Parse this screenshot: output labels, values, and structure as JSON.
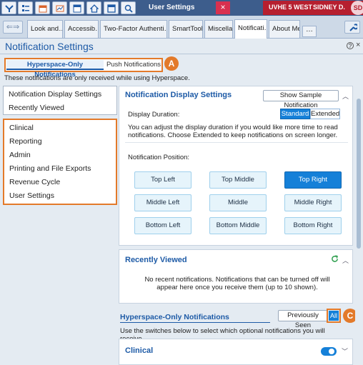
{
  "window": {
    "title": "User Settings",
    "close_glyph": "×",
    "department": "UVHE 5 WEST",
    "user_name": "SIDNEY D.",
    "avatar_initials": "SD"
  },
  "toolbar_icons": [
    "epic-logo-icon",
    "list-icon",
    "calendar-icon",
    "chart-icon",
    "panel-icon",
    "home-icon",
    "window-icon",
    "search-icon"
  ],
  "tabs": [
    {
      "label": "Look and…"
    },
    {
      "label": "Accessib…"
    },
    {
      "label": "Two-Factor Authenti…"
    },
    {
      "label": "SmartTools"
    },
    {
      "label": "Miscella…"
    },
    {
      "label": "Notificati…"
    },
    {
      "label": "About Me"
    }
  ],
  "tab_more": "…",
  "nav_arrows": "⇐⇒",
  "header": {
    "title": "Notification Settings",
    "help": "?",
    "close": "×"
  },
  "mode_tabs": {
    "hyperspace": "Hyperspace-Only Notifications",
    "push": "Push Notifications"
  },
  "info_line": "These notifications are only received while using Hyperspace.",
  "callouts": {
    "a": "A",
    "b": "B",
    "c": "C"
  },
  "sidebar": {
    "top_items": [
      "Notification Display Settings",
      "Recently Viewed"
    ],
    "group_items": [
      "Clinical",
      "Reporting",
      "Admin",
      "Printing and File Exports",
      "Revenue Cycle",
      "User Settings"
    ]
  },
  "display_card": {
    "title": "Notification Display Settings",
    "sample_button": "Show Sample Notification",
    "duration_label": "Display Duration:",
    "duration_options": [
      "Standard",
      "Extended"
    ],
    "duration_selected": "Standard",
    "duration_help": "You can adjust the display duration if you would like more time to read notifications. Choose Extended to keep notifications on screen longer.",
    "position_label": "Notification Position:",
    "positions": [
      "Top Left",
      "Top Middle",
      "Top Right",
      "Middle Left",
      "Middle",
      "Middle Right",
      "Bottom Left",
      "Bottom Middle",
      "Bottom Right"
    ],
    "position_selected": "Top Right"
  },
  "recent_card": {
    "title": "Recently Viewed",
    "empty_text": "No recent notifications. Notifications that can be turned off will appear here once you receive them (up to 10 shown)."
  },
  "hyperspace_section": {
    "title": "Hyperspace-Only Notifications",
    "filter_options": [
      "Previously Seen",
      "All"
    ],
    "filter_selected": "All",
    "help": "Use the switches below to select which optional notifications you will receive."
  },
  "clinical_card": {
    "title": "Clinical",
    "toggle_on": true
  },
  "colors": {
    "accent": "#1d5aa6",
    "selected": "#1580d8",
    "callout": "#e37a2a",
    "user_badge": "#b61f2f"
  }
}
